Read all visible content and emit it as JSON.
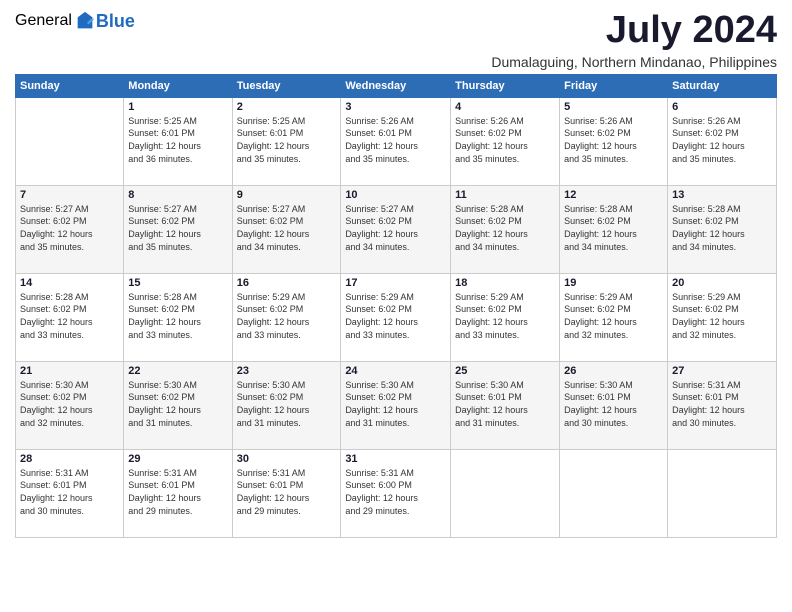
{
  "header": {
    "logo_general": "General",
    "logo_blue": "Blue",
    "month_year": "July 2024",
    "location": "Dumalaguing, Northern Mindanao, Philippines"
  },
  "calendar": {
    "days_of_week": [
      "Sunday",
      "Monday",
      "Tuesday",
      "Wednesday",
      "Thursday",
      "Friday",
      "Saturday"
    ],
    "weeks": [
      [
        {
          "day": "",
          "info": ""
        },
        {
          "day": "1",
          "info": "Sunrise: 5:25 AM\nSunset: 6:01 PM\nDaylight: 12 hours\nand 36 minutes."
        },
        {
          "day": "2",
          "info": "Sunrise: 5:25 AM\nSunset: 6:01 PM\nDaylight: 12 hours\nand 35 minutes."
        },
        {
          "day": "3",
          "info": "Sunrise: 5:26 AM\nSunset: 6:01 PM\nDaylight: 12 hours\nand 35 minutes."
        },
        {
          "day": "4",
          "info": "Sunrise: 5:26 AM\nSunset: 6:02 PM\nDaylight: 12 hours\nand 35 minutes."
        },
        {
          "day": "5",
          "info": "Sunrise: 5:26 AM\nSunset: 6:02 PM\nDaylight: 12 hours\nand 35 minutes."
        },
        {
          "day": "6",
          "info": "Sunrise: 5:26 AM\nSunset: 6:02 PM\nDaylight: 12 hours\nand 35 minutes."
        }
      ],
      [
        {
          "day": "7",
          "info": "Sunrise: 5:27 AM\nSunset: 6:02 PM\nDaylight: 12 hours\nand 35 minutes."
        },
        {
          "day": "8",
          "info": "Sunrise: 5:27 AM\nSunset: 6:02 PM\nDaylight: 12 hours\nand 35 minutes."
        },
        {
          "day": "9",
          "info": "Sunrise: 5:27 AM\nSunset: 6:02 PM\nDaylight: 12 hours\nand 34 minutes."
        },
        {
          "day": "10",
          "info": "Sunrise: 5:27 AM\nSunset: 6:02 PM\nDaylight: 12 hours\nand 34 minutes."
        },
        {
          "day": "11",
          "info": "Sunrise: 5:28 AM\nSunset: 6:02 PM\nDaylight: 12 hours\nand 34 minutes."
        },
        {
          "day": "12",
          "info": "Sunrise: 5:28 AM\nSunset: 6:02 PM\nDaylight: 12 hours\nand 34 minutes."
        },
        {
          "day": "13",
          "info": "Sunrise: 5:28 AM\nSunset: 6:02 PM\nDaylight: 12 hours\nand 34 minutes."
        }
      ],
      [
        {
          "day": "14",
          "info": "Sunrise: 5:28 AM\nSunset: 6:02 PM\nDaylight: 12 hours\nand 33 minutes."
        },
        {
          "day": "15",
          "info": "Sunrise: 5:28 AM\nSunset: 6:02 PM\nDaylight: 12 hours\nand 33 minutes."
        },
        {
          "day": "16",
          "info": "Sunrise: 5:29 AM\nSunset: 6:02 PM\nDaylight: 12 hours\nand 33 minutes."
        },
        {
          "day": "17",
          "info": "Sunrise: 5:29 AM\nSunset: 6:02 PM\nDaylight: 12 hours\nand 33 minutes."
        },
        {
          "day": "18",
          "info": "Sunrise: 5:29 AM\nSunset: 6:02 PM\nDaylight: 12 hours\nand 33 minutes."
        },
        {
          "day": "19",
          "info": "Sunrise: 5:29 AM\nSunset: 6:02 PM\nDaylight: 12 hours\nand 32 minutes."
        },
        {
          "day": "20",
          "info": "Sunrise: 5:29 AM\nSunset: 6:02 PM\nDaylight: 12 hours\nand 32 minutes."
        }
      ],
      [
        {
          "day": "21",
          "info": "Sunrise: 5:30 AM\nSunset: 6:02 PM\nDaylight: 12 hours\nand 32 minutes."
        },
        {
          "day": "22",
          "info": "Sunrise: 5:30 AM\nSunset: 6:02 PM\nDaylight: 12 hours\nand 31 minutes."
        },
        {
          "day": "23",
          "info": "Sunrise: 5:30 AM\nSunset: 6:02 PM\nDaylight: 12 hours\nand 31 minutes."
        },
        {
          "day": "24",
          "info": "Sunrise: 5:30 AM\nSunset: 6:02 PM\nDaylight: 12 hours\nand 31 minutes."
        },
        {
          "day": "25",
          "info": "Sunrise: 5:30 AM\nSunset: 6:01 PM\nDaylight: 12 hours\nand 31 minutes."
        },
        {
          "day": "26",
          "info": "Sunrise: 5:30 AM\nSunset: 6:01 PM\nDaylight: 12 hours\nand 30 minutes."
        },
        {
          "day": "27",
          "info": "Sunrise: 5:31 AM\nSunset: 6:01 PM\nDaylight: 12 hours\nand 30 minutes."
        }
      ],
      [
        {
          "day": "28",
          "info": "Sunrise: 5:31 AM\nSunset: 6:01 PM\nDaylight: 12 hours\nand 30 minutes."
        },
        {
          "day": "29",
          "info": "Sunrise: 5:31 AM\nSunset: 6:01 PM\nDaylight: 12 hours\nand 29 minutes."
        },
        {
          "day": "30",
          "info": "Sunrise: 5:31 AM\nSunset: 6:01 PM\nDaylight: 12 hours\nand 29 minutes."
        },
        {
          "day": "31",
          "info": "Sunrise: 5:31 AM\nSunset: 6:00 PM\nDaylight: 12 hours\nand 29 minutes."
        },
        {
          "day": "",
          "info": ""
        },
        {
          "day": "",
          "info": ""
        },
        {
          "day": "",
          "info": ""
        }
      ]
    ]
  }
}
